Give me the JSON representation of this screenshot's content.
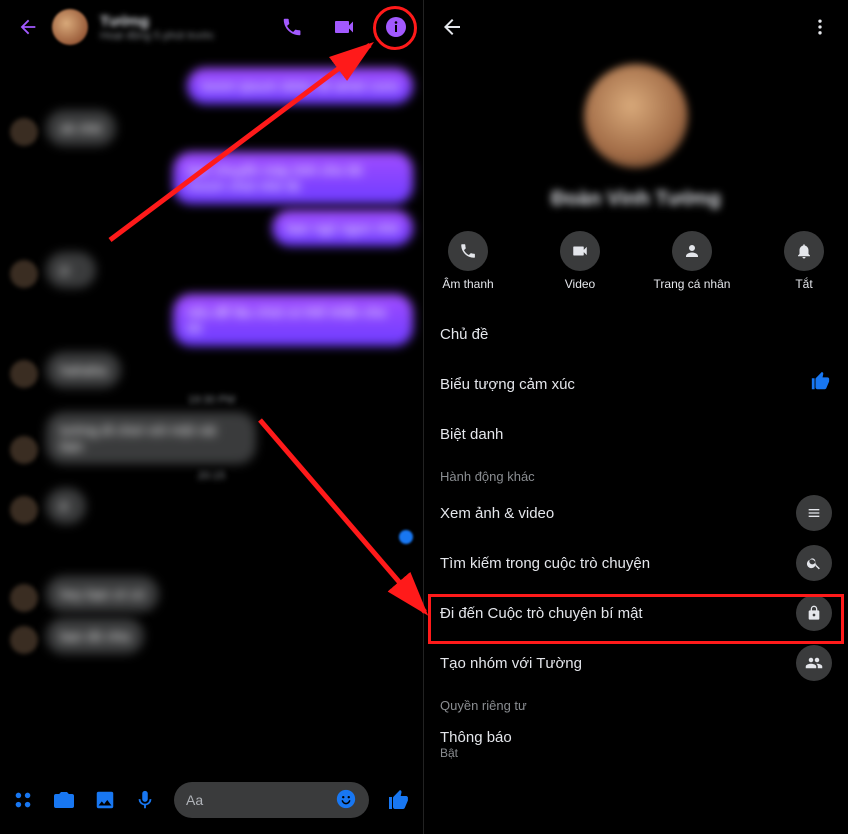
{
  "left": {
    "contact_name": "Tường",
    "status_sub": "Hoạt động 5 phút trước",
    "messages": [
      {
        "side": "right",
        "text": "lorem ipsum dolor sit amet cons"
      },
      {
        "side": "left",
        "text": "ok nhé"
      },
      {
        "side": "right",
        "text": "bạn chuyển máy tính cho tôi mượn chút nhé đc"
      },
      {
        "side": "right",
        "text": "bạn ngủ ngon nhé"
      },
      {
        "side": "left",
        "text": "ừ"
      },
      {
        "side": "right",
        "text": "nếu để lâu chút có thể nhắn cho tôi"
      },
      {
        "side": "left",
        "text": "hahaha"
      }
    ],
    "timestamp_mid": "19:30 PM",
    "messages2": [
      {
        "side": "left",
        "text": "tường đi chơi với một vài bạn"
      }
    ],
    "timestamp_mid2": "20:15",
    "messages3": [
      {
        "side": "left",
        "text": "ê"
      }
    ],
    "messages4": [
      {
        "side": "left",
        "text": "hey bạn ơi có"
      },
      {
        "side": "left",
        "text": "bạn đó nha"
      }
    ],
    "composer_placeholder": "Aa"
  },
  "right": {
    "profile_name": "Đoàn Vinh Tường",
    "actions": {
      "audio": "Âm thanh",
      "video": "Video",
      "profile": "Trang cá nhân",
      "mute": "Tắt"
    },
    "rows": {
      "theme": "Chủ đề",
      "emoji": "Biểu tượng cảm xúc",
      "nickname": "Biệt danh",
      "section_more": "Hành động khác",
      "media": "Xem ảnh & video",
      "search": "Tìm kiếm trong cuộc trò chuyện",
      "secret": "Đi đến Cuộc trò chuyện bí mật",
      "group": "Tạo nhóm với Tường",
      "section_privacy": "Quyền riêng tư",
      "notif": "Thông báo",
      "notif_sub": "Bật"
    }
  }
}
